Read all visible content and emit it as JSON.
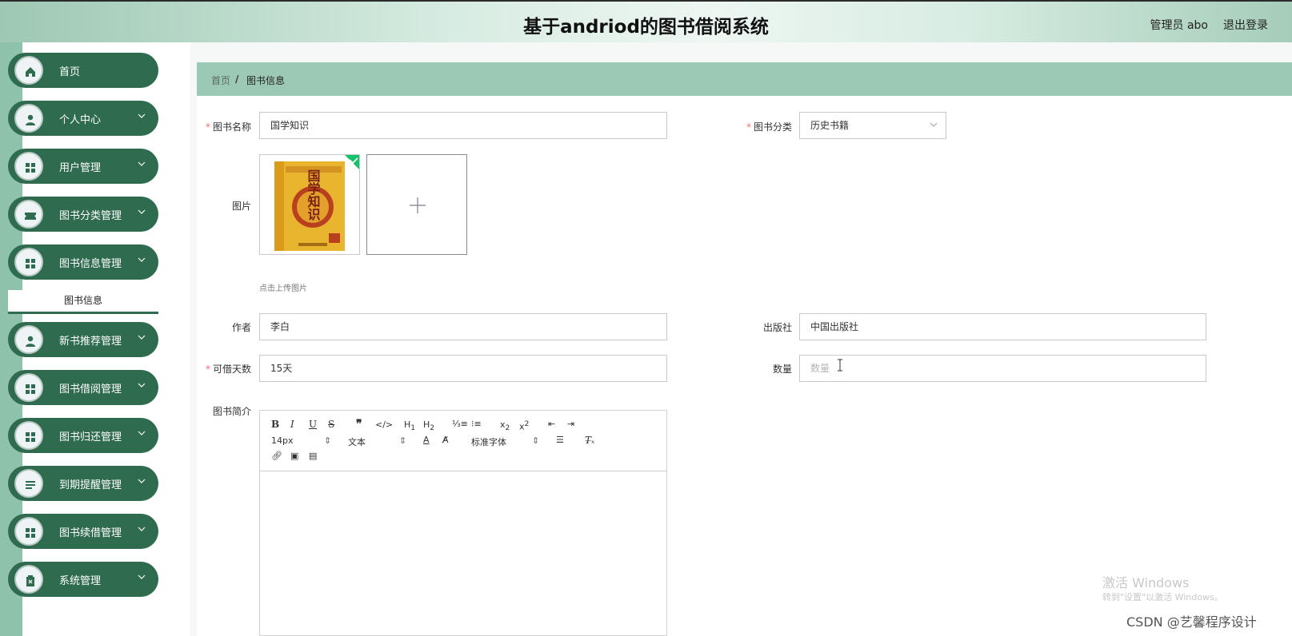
{
  "header": {
    "title": "基于andriod的图书借阅系统",
    "admin": "管理员 abo",
    "logout": "退出登录"
  },
  "sidebar": {
    "items": [
      {
        "label": "首页",
        "icon": "home-icon",
        "has_chevron": false
      },
      {
        "label": "个人中心",
        "icon": "user-icon",
        "has_chevron": true
      },
      {
        "label": "用户管理",
        "icon": "grid-icon",
        "has_chevron": true
      },
      {
        "label": "图书分类管理",
        "icon": "ticket-icon",
        "has_chevron": true
      },
      {
        "label": "图书信息管理",
        "icon": "grid-icon",
        "has_chevron": true
      },
      {
        "label": "新书推荐管理",
        "icon": "user-icon",
        "has_chevron": true
      },
      {
        "label": "图书借阅管理",
        "icon": "grid-icon",
        "has_chevron": true
      },
      {
        "label": "图书归还管理",
        "icon": "grid-icon",
        "has_chevron": true
      },
      {
        "label": "到期提醒管理",
        "icon": "list-icon",
        "has_chevron": true
      },
      {
        "label": "图书续借管理",
        "icon": "grid-icon",
        "has_chevron": true
      },
      {
        "label": "系统管理",
        "icon": "clipboard-icon",
        "has_chevron": true
      }
    ],
    "submenu_active": "图书信息"
  },
  "breadcrumb": {
    "home": "首页",
    "separator": "/",
    "current": "图书信息"
  },
  "form": {
    "book_name": {
      "label": "图书名称",
      "value": "国学知识",
      "required": true
    },
    "category": {
      "label": "图书分类",
      "value": "历史书籍",
      "required": true
    },
    "image": {
      "label": "图片",
      "hint": "点击上传图片",
      "cover_text": "国学知识"
    },
    "author": {
      "label": "作者",
      "value": "李白"
    },
    "publisher": {
      "label": "出版社",
      "value": "中国出版社"
    },
    "borrow_days": {
      "label": "可借天数",
      "value": "15天",
      "required": true
    },
    "quantity": {
      "label": "数量",
      "placeholder": "数量"
    },
    "intro": {
      "label": "图书简介"
    }
  },
  "editor": {
    "font_size": "14px",
    "text_type": "文本",
    "font_family": "标准字体"
  },
  "watermark": {
    "line1": "激活 Windows",
    "line2": "转到\"设置\"以激活 Windows。",
    "csdn": "CSDN @艺馨程序设计"
  },
  "colors": {
    "menu_bg": "#2f6b4f",
    "breadcrumb_bg": "#9cc8b6",
    "required": "#f56c6c"
  }
}
